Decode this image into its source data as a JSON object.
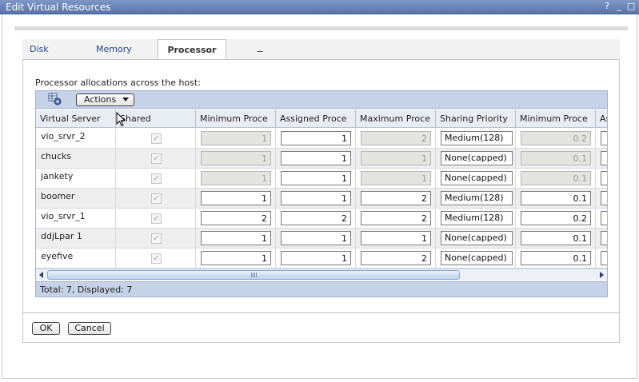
{
  "window": {
    "title": "Edit Virtual Resources",
    "help_label": "?",
    "minimize_label": "_",
    "maximize_label": "□"
  },
  "tabs": [
    {
      "label": "Disk"
    },
    {
      "label": "Memory"
    },
    {
      "label": "Processor"
    }
  ],
  "tabs_more_label": "_",
  "description": "Processor allocations across the host:",
  "toolbar": {
    "icon": "table-settings-icon",
    "actions_label": "Actions"
  },
  "columns": [
    "Virtual Server",
    "Shared",
    "Minimum Proce",
    "Assigned Proce",
    "Maximum Proce",
    "Sharing Priority",
    "Minimum Proce",
    "As"
  ],
  "rows": [
    {
      "name": "vio_srvr_2",
      "shared": "✓",
      "min": "1",
      "assigned": "1",
      "max": "2",
      "priority": "Medium(128)",
      "min_units": "0.2",
      "disabled": true
    },
    {
      "name": "chucks",
      "shared": "✓",
      "min": "1",
      "assigned": "1",
      "max": "1",
      "priority": "None(capped)",
      "min_units": "0.1",
      "disabled": true
    },
    {
      "name": "jankety",
      "shared": "✓",
      "min": "1",
      "assigned": "1",
      "max": "1",
      "priority": "None(capped)",
      "min_units": "0.1",
      "disabled": true
    },
    {
      "name": "boomer",
      "shared": "✓",
      "min": "1",
      "assigned": "1",
      "max": "2",
      "priority": "Medium(128)",
      "min_units": "0.1",
      "disabled": false
    },
    {
      "name": "vio_srvr_1",
      "shared": "✓",
      "min": "2",
      "assigned": "2",
      "max": "2",
      "priority": "Medium(128)",
      "min_units": "0.2",
      "disabled": false
    },
    {
      "name": "ddjLpar 1",
      "shared": "✓",
      "min": "1",
      "assigned": "1",
      "max": "1",
      "priority": "None(capped)",
      "min_units": "0.1",
      "disabled": false
    },
    {
      "name": "eyefive",
      "shared": "✓",
      "min": "1",
      "assigned": "1",
      "max": "2",
      "priority": "None(capped)",
      "min_units": "0.1",
      "disabled": false
    }
  ],
  "scrollbar_grip": "|||",
  "footer": {
    "summary": "Total: 7, Displayed: 7"
  },
  "buttons": {
    "ok_label": "OK",
    "cancel_label": "Cancel"
  },
  "colors": {
    "title_bar": "#6b84b8",
    "toolbar": "#c5d2e8",
    "header": "#e8ecf3"
  }
}
